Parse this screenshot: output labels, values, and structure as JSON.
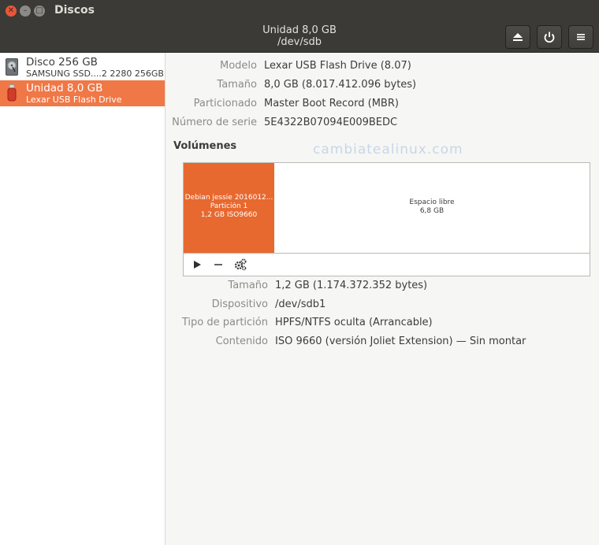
{
  "window": {
    "title": "Discos"
  },
  "header": {
    "title": "Unidad 8,0 GB",
    "subtitle": "/dev/sdb"
  },
  "sidebar": {
    "items": [
      {
        "name": "Disco 256 GB",
        "sub": "SAMSUNG SSD....2 2280 256GB"
      },
      {
        "name": "Unidad 8,0 GB",
        "sub": "Lexar USB Flash Drive"
      }
    ]
  },
  "drive_info": [
    {
      "label": "Modelo",
      "value": "Lexar USB Flash Drive (8.07)"
    },
    {
      "label": "Tamaño",
      "value": "8,0 GB (8.017.412.096 bytes)"
    },
    {
      "label": "Particionado",
      "value": "Master Boot Record (MBR)"
    },
    {
      "label": "Número de serie",
      "value": "5E4322B07094E009BEDC"
    }
  ],
  "volumes": {
    "header": "Volúmenes",
    "watermark": "cambiatealinux.com",
    "partition": {
      "line1": "Debian jessie 2016012...",
      "line2": "Partición 1",
      "line3": "1,2 GB ISO9660"
    },
    "free": {
      "line1": "Espacio libre",
      "line2": "6,8 GB"
    }
  },
  "partition_info": [
    {
      "label": "Tamaño",
      "value": "1,2 GB (1.174.372.352 bytes)"
    },
    {
      "label": "Dispositivo",
      "value": "/dev/sdb1"
    },
    {
      "label": "Tipo de partición",
      "value": "HPFS/NTFS oculta (Arrancable)"
    },
    {
      "label": "Contenido",
      "value": "ISO 9660 (versión Joliet Extension) — Sin montar"
    }
  ],
  "icons": {
    "close": "close-icon",
    "minimize": "minimize-icon",
    "maximize": "maximize-icon",
    "eject": "eject-icon",
    "power": "power-icon",
    "menu": "hamburger-menu-icon",
    "play": "play-icon",
    "minus": "minus-icon",
    "settings": "gears-icon"
  },
  "colors": {
    "accent": "#f07746",
    "partition": "#e8692f",
    "titlebar": "#3b3a36"
  }
}
